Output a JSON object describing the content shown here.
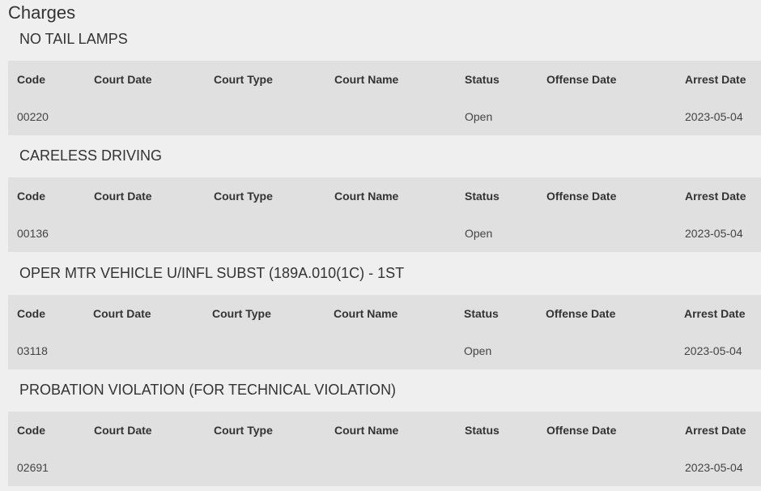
{
  "page": {
    "title": "Charges"
  },
  "columns": [
    "Code",
    "Court Date",
    "Court Type",
    "Court Name",
    "Status",
    "Offense Date",
    "Arrest Date"
  ],
  "charges": [
    {
      "name": "NO TAIL LAMPS",
      "code": "00220",
      "court_date": "",
      "court_type": "",
      "court_name": "",
      "status": "Open",
      "offense_date": "",
      "arrest_date": "2023-05-04"
    },
    {
      "name": "CARELESS DRIVING",
      "code": "00136",
      "court_date": "",
      "court_type": "",
      "court_name": "",
      "status": "Open",
      "offense_date": "",
      "arrest_date": "2023-05-04"
    },
    {
      "name": "OPER MTR VEHICLE U/INFL SUBST (189A.010(1C) - 1ST",
      "code": "03118",
      "court_date": "",
      "court_type": "",
      "court_name": "",
      "status": "Open",
      "offense_date": "",
      "arrest_date": "2023-05-04"
    },
    {
      "name": "PROBATION VIOLATION (FOR TECHNICAL VIOLATION)",
      "code": "02691",
      "court_date": "",
      "court_type": "",
      "court_name": "",
      "status": "",
      "offense_date": "",
      "arrest_date": "2023-05-04"
    }
  ]
}
